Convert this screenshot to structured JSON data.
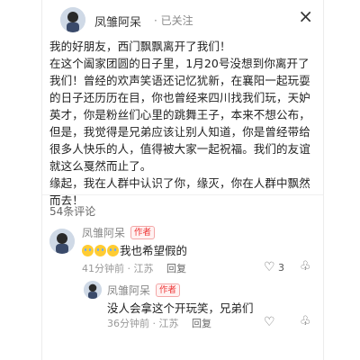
{
  "post": {
    "author": "凤雏阿呆",
    "follow_state": "· 已关注",
    "close_icon": "close-icon",
    "body": "我的好朋友，西门飘飘离开了我们！\n在这个阖家团圆的日子里，1月20号没想到你离开了我们！曾经的欢声笑语还记忆犹新，在襄阳一起玩耍的日子还历历在目，你也曾经来四川找我们玩，天妒英才，你是粉丝们心里的跳舞王子，本来不想公布，但是，我觉得是兄弟应该让别人知道，你是曾经带给很多人快乐的人，值得被大家一起祝福。我们的友谊就这么戛然而止了。\n缘起，我在人群中认识了你，缘灭，你在人群中飘然而去！"
  },
  "comments": {
    "count_label": "54条评论",
    "items": [
      {
        "name": "凤雏阿呆",
        "badge": "作者",
        "text": "我也希望假的",
        "emoji_count": 3,
        "meta": "41分钟前 · 江苏",
        "reply": "回复",
        "likes": "3",
        "like_icon": "heart-icon",
        "dislike_icon": "dislike-icon"
      },
      {
        "name": "凤雏阿呆",
        "badge": "作者",
        "text": "没人会拿这个开玩笑，兄弟们",
        "meta": "36分钟前 · 江苏",
        "reply": "回复",
        "like_icon": "heart-icon",
        "dislike_icon": "dislike-icon"
      }
    ]
  }
}
